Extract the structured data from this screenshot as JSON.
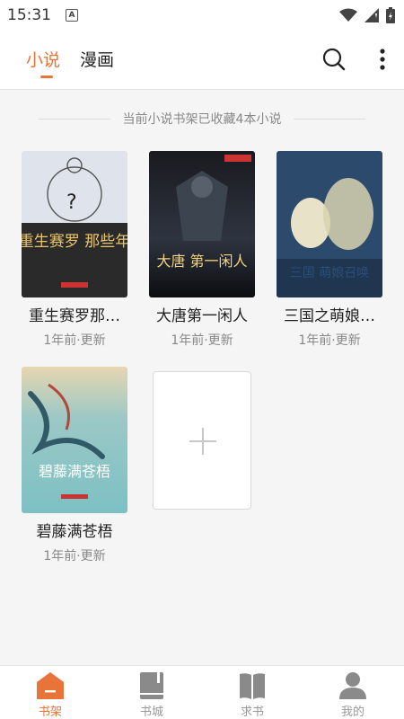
{
  "status": {
    "time": "15:31",
    "notif": "A"
  },
  "header": {
    "tabs": [
      {
        "label": "小说"
      },
      {
        "label": "漫画"
      }
    ]
  },
  "shelf_info": "当前小说书架已收藏4本小说",
  "books": [
    {
      "title": "重生赛罗那…",
      "meta": "1年前·更新",
      "cover_text": "重生赛罗 那些年"
    },
    {
      "title": "大唐第一闲人",
      "meta": "1年前·更新",
      "cover_text": "大唐 第一闲人"
    },
    {
      "title": "三国之萌娘…",
      "meta": "1年前·更新",
      "cover_text": "三国 萌娘召唤"
    },
    {
      "title": "碧藤满苍梧",
      "meta": "1年前·更新",
      "cover_text": "碧藤满苍梧"
    }
  ],
  "bottom_nav": [
    {
      "label": "书架"
    },
    {
      "label": "书城"
    },
    {
      "label": "求书"
    },
    {
      "label": "我的"
    }
  ],
  "colors": {
    "accent": "#e8743a",
    "inactive": "#999999"
  }
}
